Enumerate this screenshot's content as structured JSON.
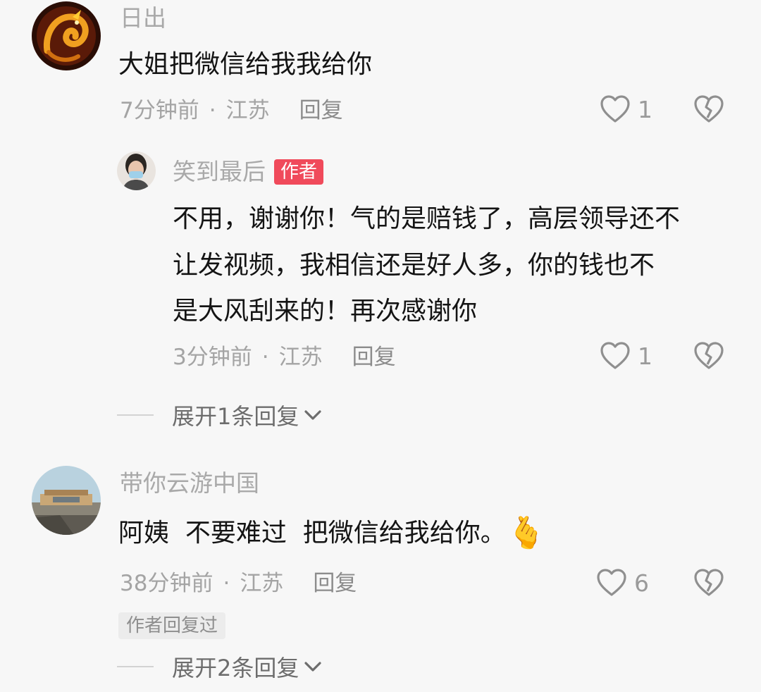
{
  "comments": [
    {
      "username": "日出",
      "text": "大姐把微信给我我给你",
      "time": "7分钟前",
      "location": "江苏",
      "reply_label": "回复",
      "likes": "1",
      "avatar_icon": "golden-dragon-avatar",
      "reply": {
        "username": "笑到最后",
        "badge": "作者",
        "lines": [
          "不用，谢谢你！气的是赔钱了，高层领导还不",
          "让发视频，我相信还是好人多，你的钱也不",
          "是大风刮来的！再次感谢你"
        ],
        "time": "3分钟前",
        "location": "江苏",
        "reply_label": "回复",
        "likes": "1",
        "avatar_icon": "masked-woman-avatar"
      },
      "expand_label": "展开1条回复"
    },
    {
      "username": "带你云游中国",
      "text": "阿姨  不要难过  把微信给我给你。",
      "emoji": "🫰",
      "time": "38分钟前",
      "location": "江苏",
      "reply_label": "回复",
      "likes": "6",
      "avatar_icon": "landscape-avatar",
      "tag": "作者回复过",
      "expand_label": "展开2条回复"
    }
  ],
  "separator": "·",
  "colors": {
    "background": "#f7f7f7",
    "badge": "#f04a5b",
    "secondary_text": "#a4a4a4",
    "primary_text": "#141414"
  }
}
